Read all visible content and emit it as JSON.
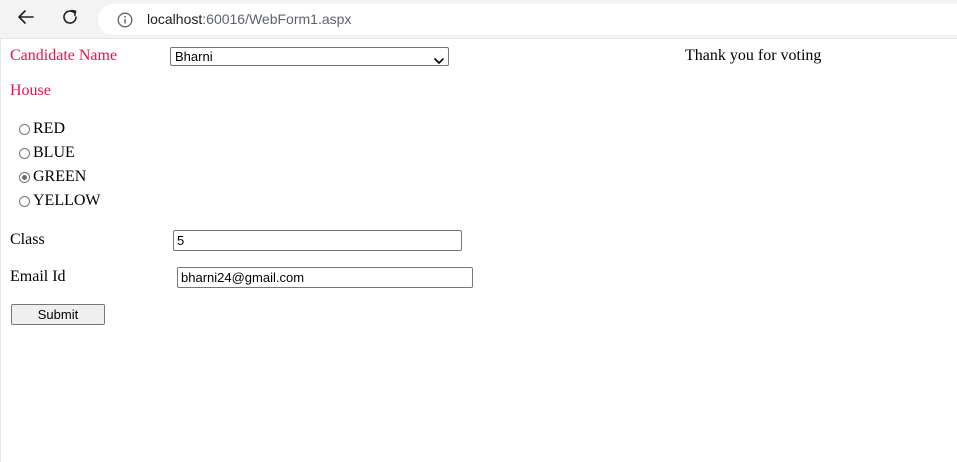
{
  "browser": {
    "url_host": "localhost",
    "url_rest": ":60016/WebForm1.aspx",
    "back_icon": "arrow-left-icon",
    "reload_icon": "reload-icon",
    "info_icon": "info-icon"
  },
  "form": {
    "candidate_label": "Candidate Name",
    "candidate_selected": "Bharni",
    "thank_you_text": "Thank you for voting",
    "house_label": "House",
    "houses": [
      {
        "label": "RED",
        "checked": false
      },
      {
        "label": "BLUE",
        "checked": false
      },
      {
        "label": "GREEN",
        "checked": true
      },
      {
        "label": "YELLOW",
        "checked": false
      }
    ],
    "class_label": "Class",
    "class_value": "5",
    "email_label": "Email Id",
    "email_value": "bharni24@gmail.com",
    "submit_label": "Submit"
  },
  "colors": {
    "accent_label": "#e8134d"
  }
}
